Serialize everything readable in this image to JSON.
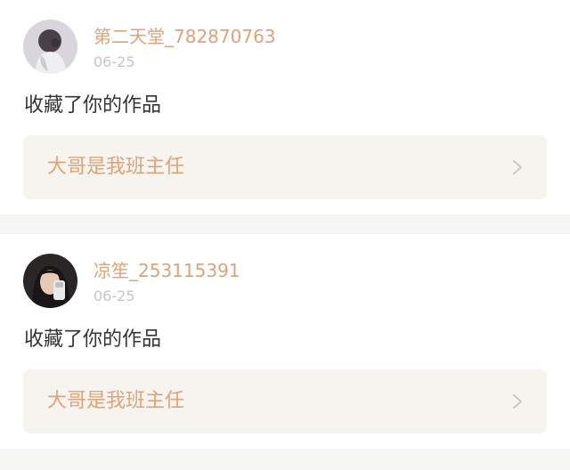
{
  "notifications": [
    {
      "username": "第二天堂_782870763",
      "date": "06-25",
      "action": "收藏了你的作品",
      "work_title": "大哥是我班主任",
      "avatar_icon": "user-avatar-icon",
      "chevron_icon": "chevron-right-icon"
    },
    {
      "username": "凉笙_253115391",
      "date": "06-25",
      "action": "收藏了你的作品",
      "work_title": "大哥是我班主任",
      "avatar_icon": "user-avatar-icon",
      "chevron_icon": "chevron-right-icon"
    }
  ],
  "colors": {
    "accent": "#e0a376",
    "text": "#333333",
    "muted": "#c5c5c5",
    "card_bg": "#f5f4ef",
    "divider": "#f6f6f4"
  }
}
